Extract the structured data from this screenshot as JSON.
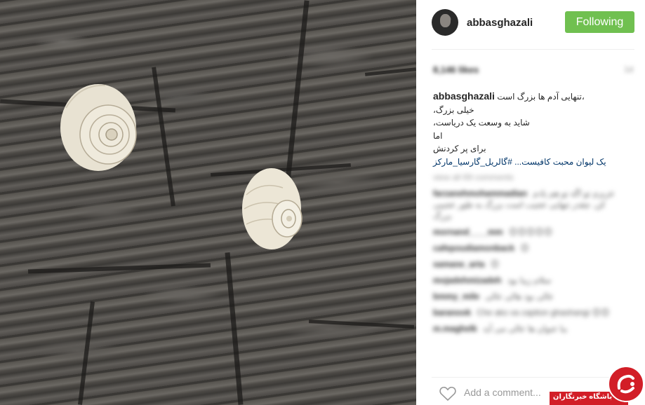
{
  "header": {
    "username": "abbasghazali",
    "follow_label": "Following",
    "avatar_icon": "avatar-photo"
  },
  "post": {
    "likes": "8,146 likes",
    "date": "1d",
    "caption": {
      "username": "abbasghazali",
      "lines": [
        "تنهایی آدم ها بزرگ است،",
        "خیلی بزرگ،",
        "شاید به وسعت یک دریاست،",
        "اما",
        "برای پر کردنش",
        "یک لیوان محبت کافیست... #گالریل_گارسیا_مارکز"
      ],
      "hashtag": "#گالریل_گارسیا_مارکز"
    }
  },
  "comments": {
    "view_all": "view all 69 comments",
    "items": [
      {
        "user": "farzanehmohammadian",
        "text": "عزیزم تو اگه تو هم یادم کن. چقدر تنهایی عجیب است بزرگ به طور عجیبی بزرگ"
      },
      {
        "user": "mornand____mm",
        "text": "😊😊😊😊😊"
      },
      {
        "user": "cafepoudiamonback",
        "text": "😊"
      },
      {
        "user": "samane_arta",
        "text": "😊"
      },
      {
        "user": "mojadehmizadeh",
        "text": "سلام زیبا بود"
      },
      {
        "user": "bmmy_mile",
        "text": "عالی بود هالی عالی"
      },
      {
        "user": "baranook",
        "text": "Che aks va caption ghashangi 😊😊"
      },
      {
        "user": "m.maghelk",
        "text": "ببا عنوان ها عالی می آید"
      }
    ]
  },
  "bottom": {
    "add_comment_placeholder": "Add a comment...",
    "heart_icon": "heart-icon"
  },
  "watermark": {
    "text": "باشگاه خبرنگاران",
    "color": "#d21e27"
  },
  "colors": {
    "follow_button": "#70c050",
    "hashtag": "#003569"
  }
}
